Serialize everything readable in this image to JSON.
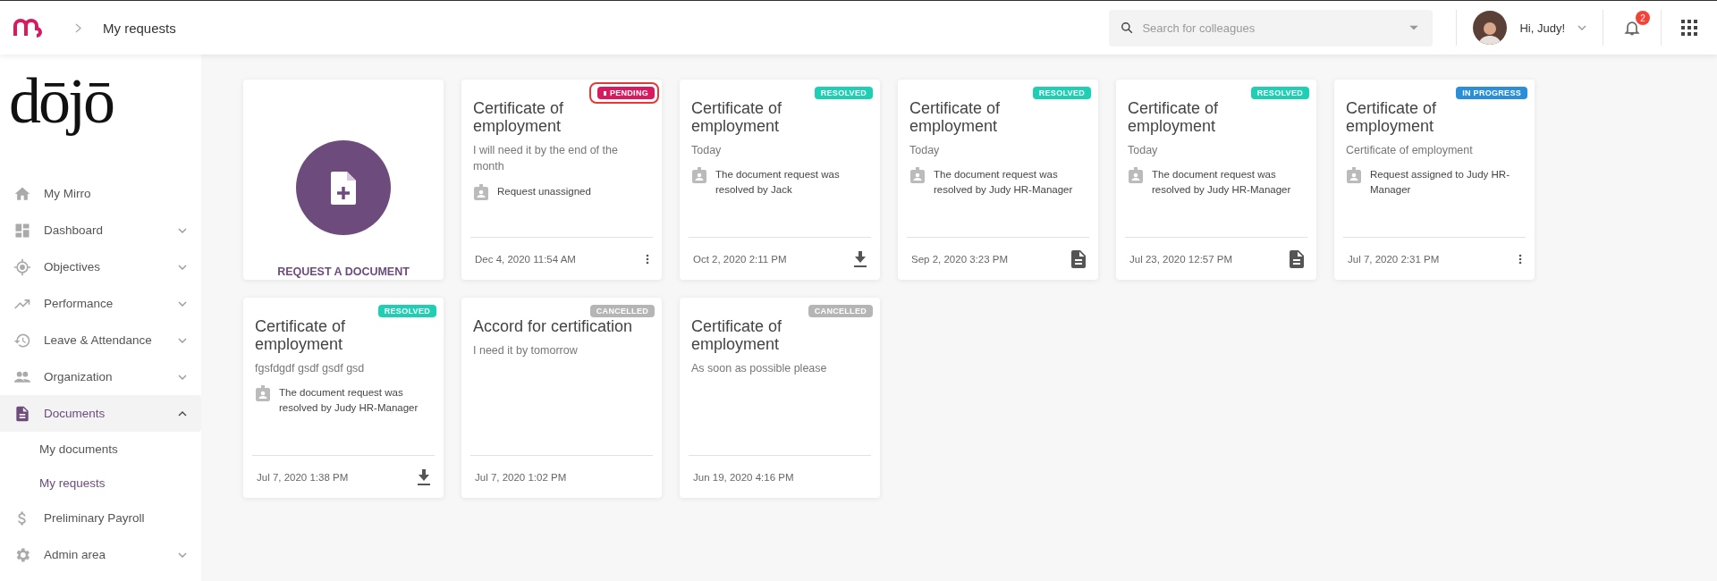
{
  "topbar": {
    "breadcrumb": "My requests",
    "search": {
      "placeholder": "Search for colleagues"
    },
    "greeting": "Hi, Judy!",
    "notifications": "2"
  },
  "sidebar": {
    "logo": "dōjō",
    "items": [
      {
        "kind": "home",
        "label": "My Mirro",
        "selected": false
      },
      {
        "kind": "dashboard",
        "label": "Dashboard",
        "expanded": false,
        "selected": false
      },
      {
        "kind": "target",
        "label": "Objectives",
        "expanded": false,
        "selected": false
      },
      {
        "kind": "trend",
        "label": "Performance",
        "expanded": false,
        "selected": false
      },
      {
        "kind": "history",
        "label": "Leave & Attendance",
        "expanded": false,
        "selected": false
      },
      {
        "kind": "people",
        "label": "Organization",
        "expanded": false,
        "selected": false
      },
      {
        "kind": "document",
        "label": "Documents",
        "expanded": true,
        "selected": true,
        "children": [
          {
            "label": "My documents",
            "selected": false
          },
          {
            "label": "My requests",
            "selected": true
          }
        ]
      },
      {
        "kind": "dollar",
        "label": "Preliminary Payroll",
        "selected": false
      },
      {
        "kind": "gear",
        "label": "Admin area",
        "expanded": false,
        "selected": false
      }
    ]
  },
  "new_request": {
    "label": "REQUEST A DOCUMENT"
  },
  "requests": [
    {
      "status": "PENDING",
      "color": "#d81b60",
      "dot": true,
      "highlighted": true,
      "title": "Certificate of employment",
      "note": "I will need it by the end of the month",
      "assignment": "Request unassigned",
      "date": "Dec 4, 2020 11:54 AM",
      "kind": "more"
    },
    {
      "status": "RESOLVED",
      "color": "#1fcfb3",
      "dot": false,
      "highlighted": false,
      "title": "Certificate of employment",
      "note": "Today",
      "assignment": "The document request was resolved by Jack",
      "date": "Oct 2, 2020 2:11 PM",
      "kind": "download"
    },
    {
      "status": "RESOLVED",
      "color": "#1fcfb3",
      "dot": false,
      "highlighted": false,
      "title": "Certificate of employment",
      "note": "Today",
      "assignment": "The document request was resolved by Judy HR-Manager",
      "date": "Sep 2, 2020 3:23 PM",
      "kind": "document"
    },
    {
      "status": "RESOLVED",
      "color": "#1fcfb3",
      "dot": false,
      "highlighted": false,
      "title": "Certificate of employment",
      "note": "Today",
      "assignment": "The document request was resolved by Judy HR-Manager",
      "date": "Jul 23, 2020 12:57 PM",
      "kind": "document"
    },
    {
      "status": "IN PROGRESS",
      "color": "#2a8fd8",
      "dot": false,
      "highlighted": false,
      "title": "Certificate of employment",
      "note": "Certificate of employment",
      "assignment": "Request assigned to Judy HR-Manager",
      "date": "Jul 7, 2020 2:31 PM",
      "kind": "more"
    },
    {
      "status": "RESOLVED",
      "color": "#1fcfb3",
      "dot": false,
      "highlighted": false,
      "title": "Certificate of employment",
      "note": "fgsfdgdf gsdf gsdf gsd",
      "assignment": "The document request was resolved by Judy HR-Manager",
      "date": "Jul 7, 2020 1:38 PM",
      "kind": "download"
    },
    {
      "status": "CANCELLED",
      "color": "#b5b5b5",
      "dot": false,
      "highlighted": false,
      "title": "Accord for certification",
      "note": "I need it by tomorrow",
      "date": "Jul 7, 2020 1:02 PM"
    },
    {
      "status": "CANCELLED",
      "color": "#b5b5b5",
      "dot": false,
      "highlighted": false,
      "title": "Certificate of employment",
      "note": "As soon as possible please",
      "date": "Jun 19, 2020 4:16 PM"
    }
  ]
}
